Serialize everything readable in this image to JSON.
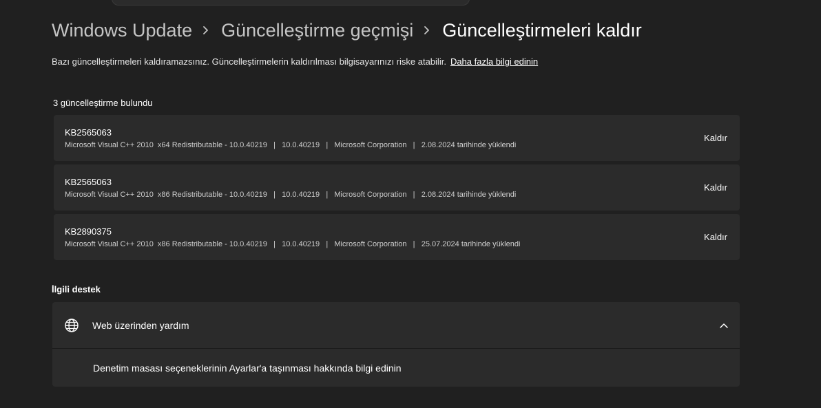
{
  "breadcrumb": {
    "items": [
      "Windows Update",
      "Güncelleştirme geçmişi",
      "Güncelleştirmeleri kaldır"
    ],
    "separator_icon": "chevron-right-icon"
  },
  "description": {
    "text": "Bazı güncelleştirmeleri kaldıramazsınız. Güncelleştirmelerin kaldırılması bilgisayarınızı riske atabilir.",
    "link": "Daha fazla bilgi edinin"
  },
  "updates": {
    "count_label": "3 güncelleştirme bulundu",
    "items": [
      {
        "kb": "KB2565063",
        "details": "Microsoft Visual C++ 2010  x64 Redistributable - 10.0.40219   |   10.0.40219   |   Microsoft Corporation   |   2.08.2024 tarihinde yüklendi",
        "action": "Kaldır"
      },
      {
        "kb": "KB2565063",
        "details": "Microsoft Visual C++ 2010  x86 Redistributable - 10.0.40219   |   10.0.40219   |   Microsoft Corporation   |   2.08.2024 tarihinde yüklendi",
        "action": "Kaldır"
      },
      {
        "kb": "KB2890375",
        "details": "Microsoft Visual C++ 2010  x86 Redistributable - 10.0.40219   |   10.0.40219   |   Microsoft Corporation   |   25.07.2024 tarihinde yüklendi",
        "action": "Kaldır"
      }
    ]
  },
  "support": {
    "heading": "İlgili destek",
    "section_title": "Web üzerinden yardım",
    "section_icon": "globe-icon",
    "expand_icon": "chevron-up-icon",
    "link": "Denetim masası seçeneklerinin Ayarlar'a taşınması hakkında bilgi edinin"
  },
  "colors": {
    "background": "#202020",
    "card": "#2b2b2b",
    "text": "#ffffff",
    "breadcrumb_inactive": "#c5c5c5"
  }
}
